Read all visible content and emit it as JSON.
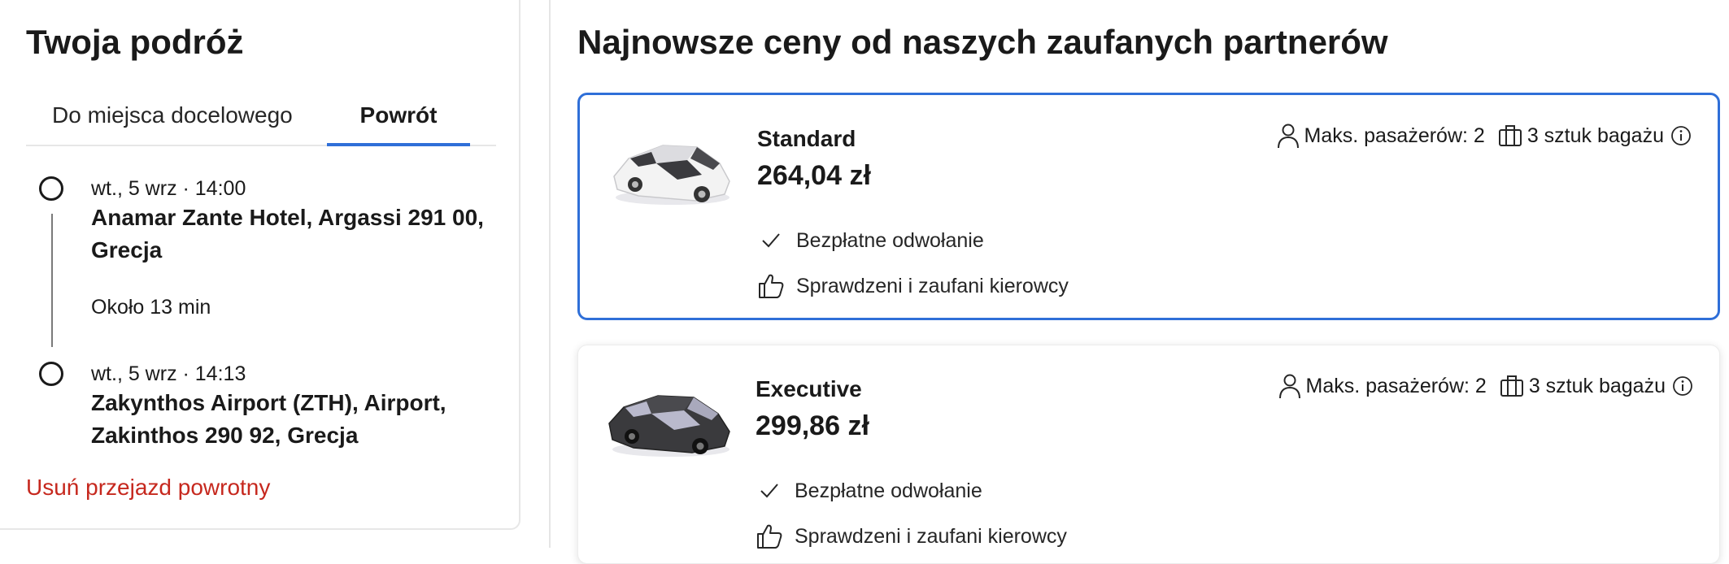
{
  "journey": {
    "title": "Twoja podróż",
    "tabs": [
      {
        "label": "Do miejsca docelowego",
        "active": false
      },
      {
        "label": "Powrót",
        "active": true
      }
    ],
    "stops": [
      {
        "time": "wt., 5 wrz · 14:00",
        "place": "Anamar Zante Hotel, Argassi 291 00, Grecja"
      },
      {
        "time": "wt., 5 wrz · 14:13",
        "place": "Zakynthos Airport (ZTH), Airport, Zakinthos 290 92, Grecja"
      }
    ],
    "duration": "Około 13 min",
    "remove_link": "Usuń przejazd powrotny"
  },
  "offers": {
    "title": "Najnowsze ceny od naszych zaufanych partnerów",
    "cards": [
      {
        "name": "Standard",
        "price": "264,04 zł",
        "passengers": "Maks. pasażerów: 2",
        "luggage": "3 sztuk bagażu",
        "features": [
          "Bezpłatne odwołanie",
          "Sprawdzeni i zaufani kierowcy"
        ],
        "car_color": "white",
        "selected": true
      },
      {
        "name": "Executive",
        "price": "299,86 zł",
        "passengers": "Maks. pasażerów: 2",
        "luggage": "3 sztuk bagażu",
        "features": [
          "Bezpłatne odwołanie",
          "Sprawdzeni i zaufani kierowcy"
        ],
        "car_color": "black",
        "selected": false
      }
    ]
  },
  "colors": {
    "accent": "#2f6fd8",
    "danger": "#c6281e",
    "text": "#1a1a1a",
    "border": "#e7e7e7"
  },
  "icons": [
    "person-icon",
    "luggage-icon",
    "info-icon",
    "check-icon",
    "thumbs-up-icon",
    "white-car-image",
    "black-car-image"
  ]
}
